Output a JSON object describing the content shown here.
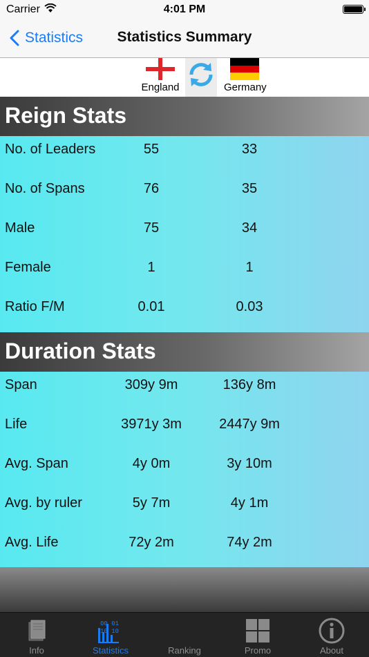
{
  "status_bar": {
    "carrier": "Carrier",
    "time": "4:01 PM"
  },
  "nav": {
    "back_label": "Statistics",
    "title": "Statistics Summary"
  },
  "countries": {
    "left": "England",
    "right": "Germany"
  },
  "reign": {
    "header": "Reign Stats",
    "rows": [
      {
        "label": "No. of Leaders",
        "v1": "55",
        "v2": "33"
      },
      {
        "label": "No. of Spans",
        "v1": "76",
        "v2": "35"
      },
      {
        "label": "Male",
        "v1": "75",
        "v2": "34"
      },
      {
        "label": "Female",
        "v1": "1",
        "v2": "1"
      },
      {
        "label": "Ratio F/M",
        "v1": "0.01",
        "v2": "0.03"
      }
    ]
  },
  "duration": {
    "header": "Duration Stats",
    "rows": [
      {
        "label": "Span",
        "v1": "309y 9m",
        "v2": "136y 8m"
      },
      {
        "label": "Life",
        "v1": "3971y 3m",
        "v2": "2447y 9m"
      },
      {
        "label": "Avg. Span",
        "v1": "4y 0m",
        "v2": "3y 10m"
      },
      {
        "label": "Avg. by ruler",
        "v1": "5y 7m",
        "v2": "4y 1m"
      },
      {
        "label": "Avg. Life",
        "v1": "72y 2m",
        "v2": "74y 2m"
      }
    ]
  },
  "tabs": [
    {
      "label": "Info",
      "icon": "book-icon"
    },
    {
      "label": "Statistics",
      "icon": "binary-chart-icon",
      "active": true
    },
    {
      "label": "Ranking",
      "icon": "ranking-icon"
    },
    {
      "label": "Promo",
      "icon": "grid-icon"
    },
    {
      "label": "About",
      "icon": "info-icon"
    }
  ],
  "colors": {
    "accent": "#1a7cf5",
    "panel": "#6ae8ef",
    "tabbar": "#242424"
  }
}
